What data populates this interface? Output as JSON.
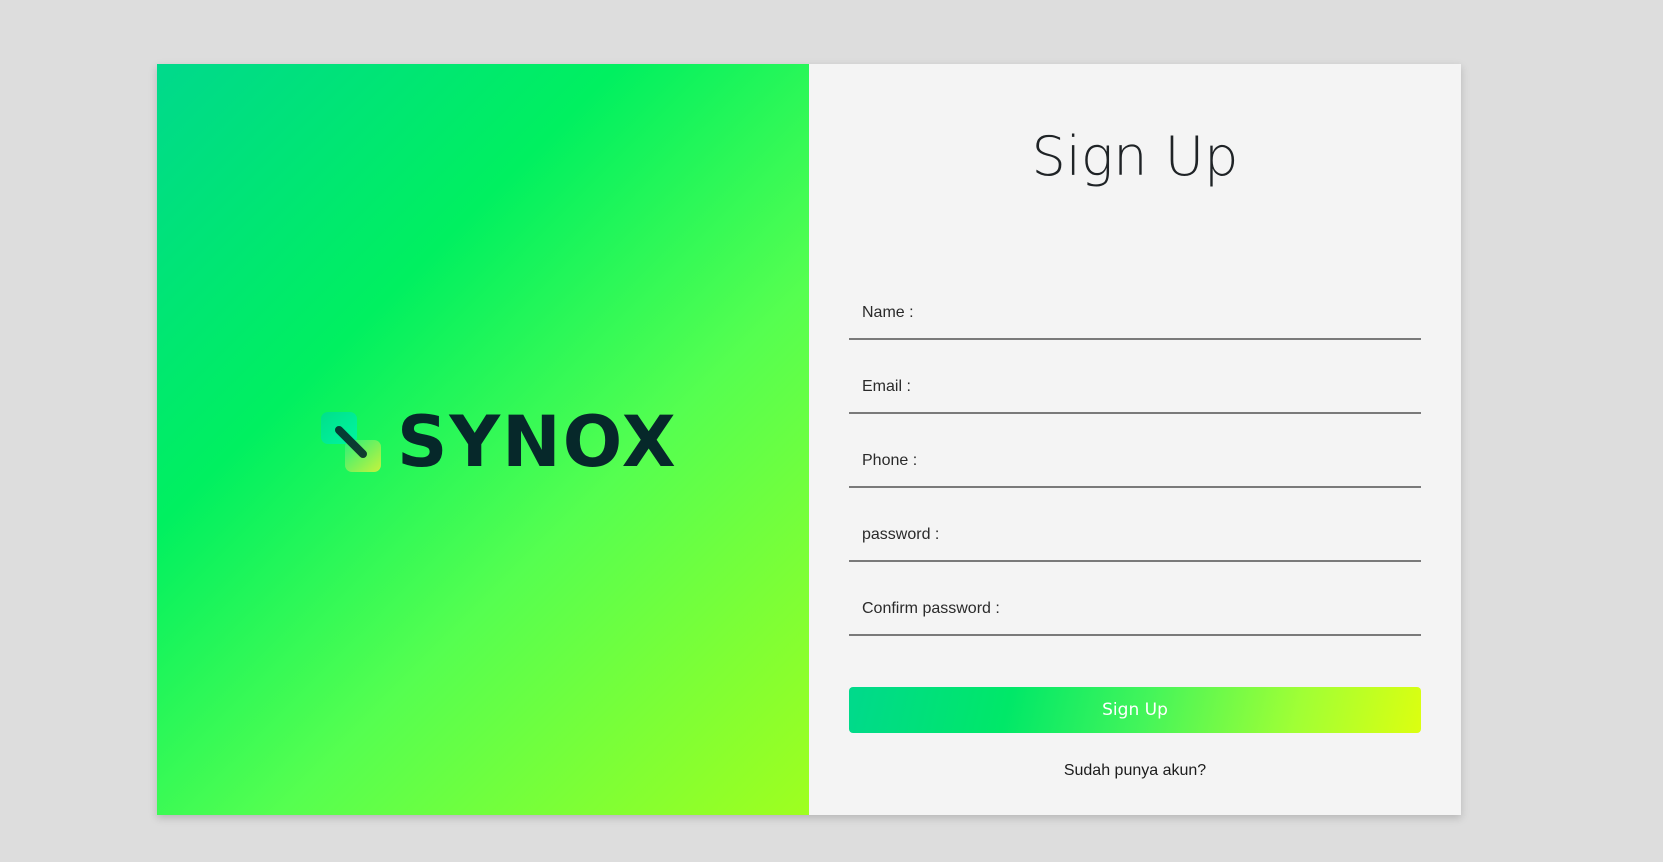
{
  "brand": {
    "name": "SYNOX",
    "logo_icon": "synox-logo-icon"
  },
  "form": {
    "title": "Sign Up",
    "fields": [
      {
        "name": "name",
        "placeholder": "Name :",
        "value": ""
      },
      {
        "name": "email",
        "placeholder": "Email :",
        "value": ""
      },
      {
        "name": "phone",
        "placeholder": "Phone :",
        "value": ""
      },
      {
        "name": "password",
        "placeholder": "password :",
        "value": ""
      },
      {
        "name": "confirm_password",
        "placeholder": "Confirm password :",
        "value": ""
      }
    ],
    "submit_label": "Sign Up",
    "login_link": "Sudah punya akun?"
  },
  "colors": {
    "page_background": "#dddddd",
    "form_background": "#f4f4f4",
    "brand_gradient": [
      "#00d98c",
      "#00f060",
      "#55ff50",
      "#9fff1f"
    ],
    "button_gradient": [
      "#00d98c",
      "#00e868",
      "#44f55a",
      "#a0ff35",
      "#dcff10"
    ],
    "logo_text": "#06282a"
  }
}
